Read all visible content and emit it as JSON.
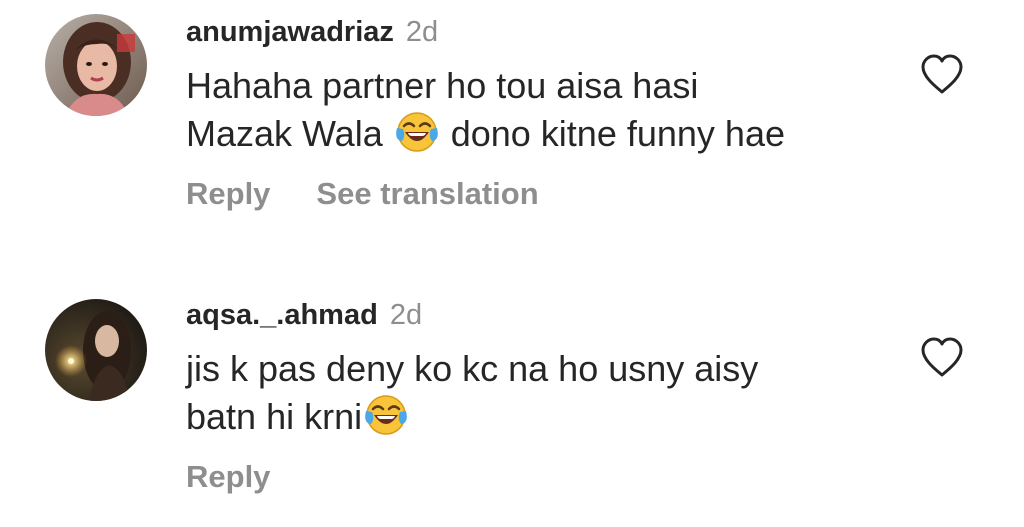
{
  "comments": [
    {
      "username": "anumjawadriaz",
      "time": "2d",
      "text_line1": "Hahaha partner ho tou aisa hasi",
      "text_line2_before": "Mazak Wala ",
      "text_line2_after": " dono kitne funny hae",
      "emoji": "face-with-tears-of-joy",
      "reply_label": "Reply",
      "translate_label": "See translation"
    },
    {
      "username": "aqsa._.ahmad",
      "time": "2d",
      "text_line1": "jis k pas deny ko kc na ho usny aisy",
      "text_line2_before": "batn hi krni",
      "emoji": "face-with-tears-of-joy",
      "reply_label": "Reply"
    }
  ],
  "colors": {
    "primary_text": "#262626",
    "secondary_text": "#8e8e8e",
    "background": "#ffffff"
  },
  "icons": {
    "like": "heart-outline-icon"
  }
}
